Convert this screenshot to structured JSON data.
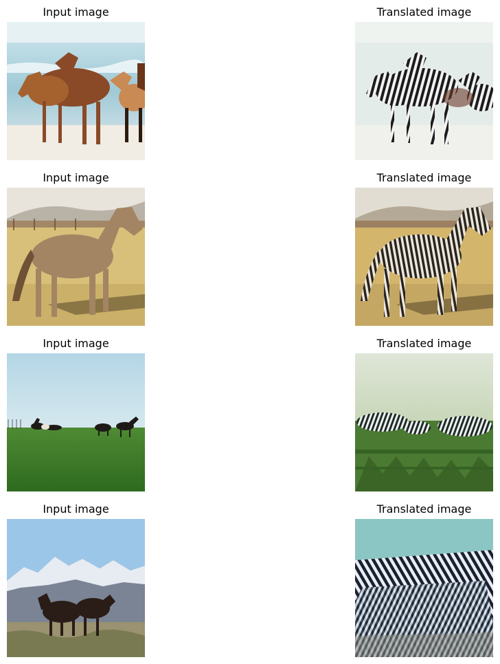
{
  "rows": [
    {
      "input": {
        "title": "Input image",
        "scene": "horses-on-beach"
      },
      "translated": {
        "title": "Translated image",
        "scene": "zebras-on-beach"
      }
    },
    {
      "input": {
        "title": "Input image",
        "scene": "horse-in-dry-field"
      },
      "translated": {
        "title": "Translated image",
        "scene": "zebra-in-dry-field"
      }
    },
    {
      "input": {
        "title": "Input image",
        "scene": "horses-on-green-meadow"
      },
      "translated": {
        "title": "Translated image",
        "scene": "zebras-on-green-meadow"
      }
    },
    {
      "input": {
        "title": "Input image",
        "scene": "horses-before-mountains"
      },
      "translated": {
        "title": "Translated image",
        "scene": "zebras-before-mountains"
      }
    }
  ]
}
